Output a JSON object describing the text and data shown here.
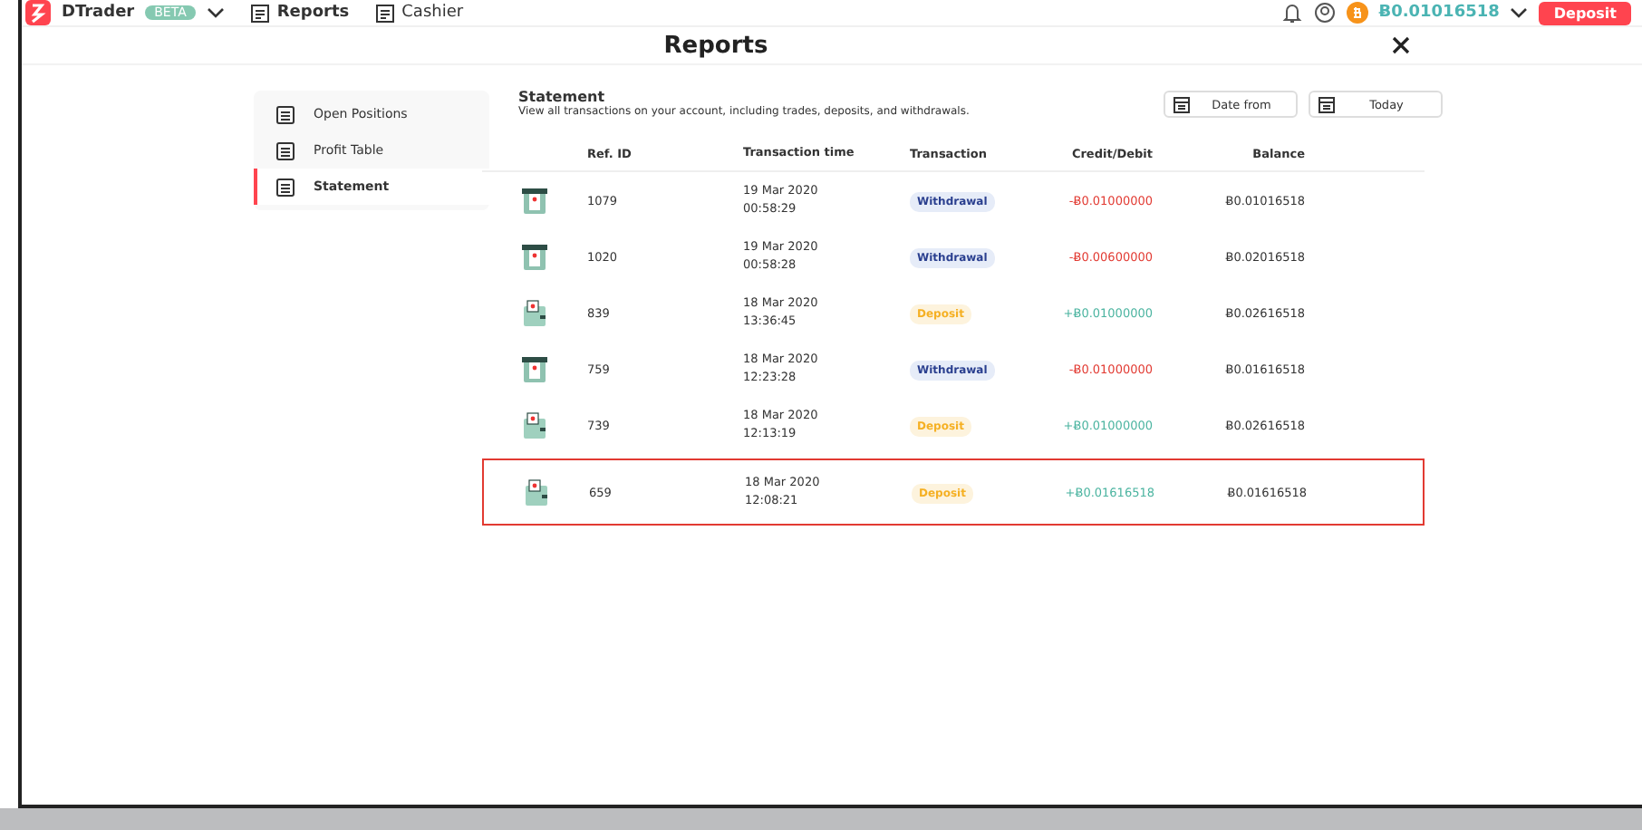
{
  "nav": {
    "brand": "DTrader",
    "badge": "BETA",
    "links": [
      {
        "label": "Reports",
        "selected": true
      },
      {
        "label": "Cashier",
        "selected": false
      }
    ],
    "balance": "Ƀ0.01016518",
    "deposit_button": "Deposit"
  },
  "modal": {
    "title": "Reports"
  },
  "sidebar": {
    "items": [
      {
        "label": "Open Positions",
        "selected": false
      },
      {
        "label": "Profit Table",
        "selected": false
      },
      {
        "label": "Statement",
        "selected": true
      }
    ]
  },
  "statement": {
    "title": "Statement",
    "description": "View all transactions on your account, including trades, deposits, and withdrawals.",
    "date_from": {
      "placeholder": "Date from"
    },
    "date_to": {
      "value": "Today"
    }
  },
  "table": {
    "columns": [
      "Ref. ID",
      "Transaction time",
      "Transaction",
      "Credit/Debit",
      "Balance"
    ],
    "rows": [
      {
        "kind": "withdrawal",
        "ref": "1079",
        "date": "19 Mar 2020",
        "time": "00:58:29",
        "transaction": "Withdrawal",
        "amount": "-Ƀ0.01000000",
        "balance": "Ƀ0.01016518",
        "highlighted": false
      },
      {
        "kind": "withdrawal",
        "ref": "1020",
        "date": "19 Mar 2020",
        "time": "00:58:28",
        "transaction": "Withdrawal",
        "amount": "-Ƀ0.00600000",
        "balance": "Ƀ0.02016518",
        "highlighted": false
      },
      {
        "kind": "deposit",
        "ref": "839",
        "date": "18 Mar 2020",
        "time": "13:36:45",
        "transaction": "Deposit",
        "amount": "+Ƀ0.01000000",
        "balance": "Ƀ0.02616518",
        "highlighted": false
      },
      {
        "kind": "withdrawal",
        "ref": "759",
        "date": "18 Mar 2020",
        "time": "12:23:28",
        "transaction": "Withdrawal",
        "amount": "-Ƀ0.01000000",
        "balance": "Ƀ0.01616518",
        "highlighted": false
      },
      {
        "kind": "deposit",
        "ref": "739",
        "date": "18 Mar 2020",
        "time": "12:13:19",
        "transaction": "Deposit",
        "amount": "+Ƀ0.01000000",
        "balance": "Ƀ0.02616518",
        "highlighted": false
      },
      {
        "kind": "deposit",
        "ref": "659",
        "date": "18 Mar 2020",
        "time": "12:08:21",
        "transaction": "Deposit",
        "amount": "+Ƀ0.01616518",
        "balance": "Ƀ0.01616518",
        "highlighted": true
      }
    ]
  }
}
